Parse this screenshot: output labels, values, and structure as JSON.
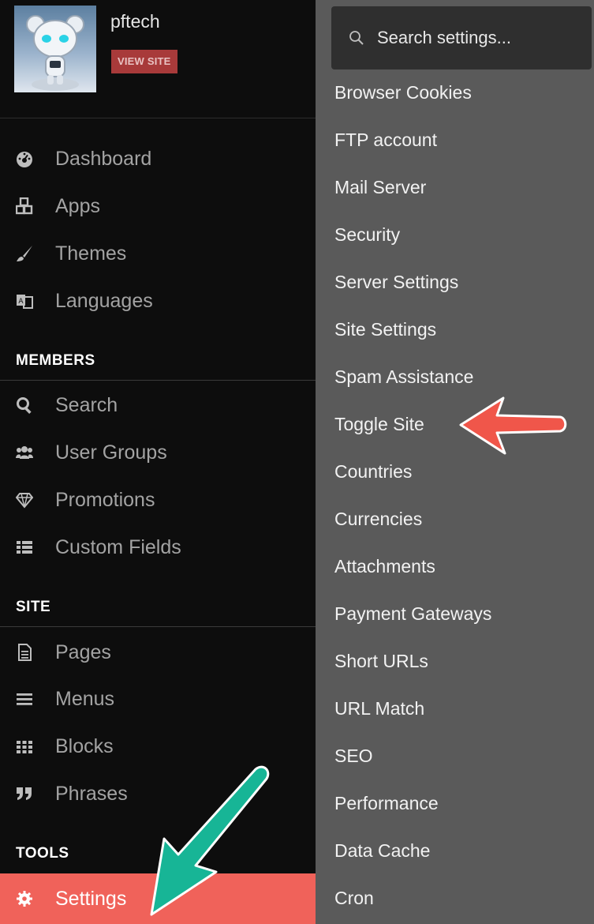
{
  "profile": {
    "site_name": "pftech",
    "view_site_label": "VIEW SITE"
  },
  "nav": {
    "main": [
      {
        "label": "Dashboard",
        "icon": "dashboard-icon"
      },
      {
        "label": "Apps",
        "icon": "cubes-icon"
      },
      {
        "label": "Themes",
        "icon": "brush-icon"
      },
      {
        "label": "Languages",
        "icon": "language-icon"
      }
    ],
    "members_title": "MEMBERS",
    "members": [
      {
        "label": "Search",
        "icon": "search-icon"
      },
      {
        "label": "User Groups",
        "icon": "users-icon"
      },
      {
        "label": "Promotions",
        "icon": "diamond-icon"
      },
      {
        "label": "Custom Fields",
        "icon": "list-icon"
      }
    ],
    "site_title": "SITE",
    "site": [
      {
        "label": "Pages",
        "icon": "file-icon"
      },
      {
        "label": "Menus",
        "icon": "bars-icon"
      },
      {
        "label": "Blocks",
        "icon": "grid-icon"
      },
      {
        "label": "Phrases",
        "icon": "quote-icon"
      }
    ],
    "tools_title": "TOOLS",
    "tools": [
      {
        "label": "Settings",
        "icon": "gear-icon",
        "active": true
      }
    ]
  },
  "settings": {
    "search_placeholder": "Search settings...",
    "items": [
      "Browser Cookies",
      "FTP account",
      "Mail Server",
      "Security",
      "Server Settings",
      "Site Settings",
      "Spam Assistance",
      "Toggle Site",
      "Countries",
      "Currencies",
      "Attachments",
      "Payment Gateways",
      "Short URLs",
      "URL Match",
      "SEO",
      "Performance",
      "Data Cache",
      "Cron"
    ]
  },
  "colors": {
    "sidebar_bg": "#0d0d0d",
    "settings_bg": "#5a5a5a",
    "active_item": "#f0625a",
    "view_site_button": "#a83a3a",
    "annotation_red": "#f0564a",
    "annotation_teal": "#17b596"
  }
}
